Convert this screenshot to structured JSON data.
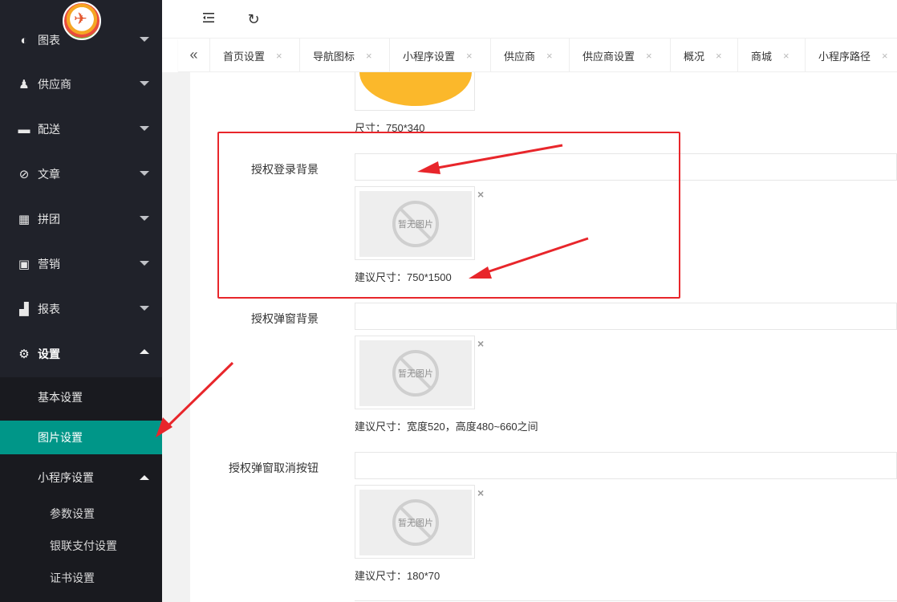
{
  "sidebar": {
    "items": [
      {
        "label": "图表",
        "icon": "chart-icon"
      },
      {
        "label": "供应商",
        "icon": "users-icon"
      },
      {
        "label": "配送",
        "icon": "truck-icon"
      },
      {
        "label": "文章",
        "icon": "compass-icon"
      },
      {
        "label": "拼团",
        "icon": "grid-icon"
      },
      {
        "label": "营销",
        "icon": "gift-icon"
      },
      {
        "label": "报表",
        "icon": "bar-chart-icon"
      },
      {
        "label": "设置",
        "icon": "gear-icon"
      }
    ],
    "submenu": {
      "basic": "基本设置",
      "image": "图片设置",
      "miniapp": "小程序设置",
      "params": "参数设置",
      "unionpay": "银联支付设置",
      "cert": "证书设置"
    }
  },
  "header": {
    "collapse_icon": "menu-collapse-icon",
    "refresh_icon": "refresh-icon"
  },
  "tabs": {
    "prev": "«",
    "items": [
      {
        "label": "首页设置",
        "close": "×"
      },
      {
        "label": "导航图标",
        "close": "×"
      },
      {
        "label": "小程序设置",
        "close": "×"
      },
      {
        "label": "供应商",
        "close": "×"
      },
      {
        "label": "供应商设置",
        "close": "×"
      },
      {
        "label": "概况",
        "close": "×"
      },
      {
        "label": "商城",
        "close": "×"
      },
      {
        "label": "小程序路径",
        "close": "×"
      }
    ]
  },
  "form": {
    "top_size": "尺寸：750*340",
    "placeholder_text": "暂无图片",
    "delete": "×",
    "fields": [
      {
        "label": "授权登录背景",
        "value": "",
        "hint": "建议尺寸：750*1500"
      },
      {
        "label": "授权弹窗背景",
        "value": "",
        "hint": "建议尺寸：宽度520，高度480~660之间"
      },
      {
        "label": "授权弹窗取消按钮",
        "value": "",
        "hint": "建议尺寸：180*70"
      }
    ]
  },
  "colors": {
    "sidebar_bg": "#20222a",
    "active_green": "#009688",
    "annotation_red": "#e8262b",
    "preview_yellow": "#fbb82b"
  }
}
